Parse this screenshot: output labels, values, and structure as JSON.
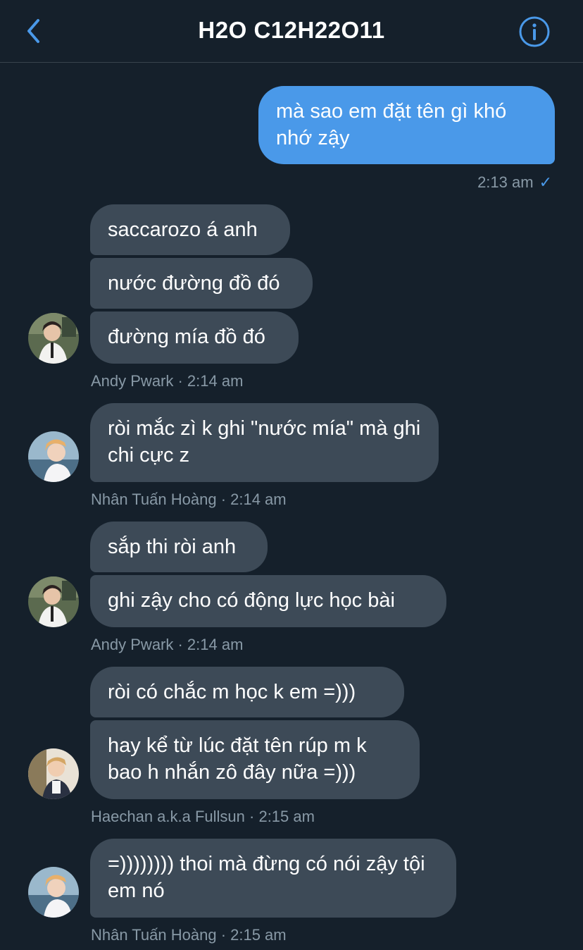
{
  "header": {
    "title": "H2O C12H22O11",
    "back_icon": "chevron-left-icon",
    "info_icon": "info-circle-icon",
    "accent": "#4a99e9"
  },
  "messages": {
    "m1": {
      "text": "mà sao em đặt tên gì khó nhớ zậy",
      "time": "2:13 am",
      "check": "✓"
    },
    "g1": {
      "bubbles": [
        "saccarozo á anh",
        "nước đường đồ đó",
        "đường mía đồ đó"
      ],
      "meta": "Andy Pwark · 2:14 am"
    },
    "g2": {
      "bubbles": [
        "ròi mắc zì k ghi \"nước mía\" mà ghi chi cực z"
      ],
      "meta": "Nhân Tuấn Hoàng · 2:14 am"
    },
    "g3": {
      "bubbles": [
        "sắp thi ròi anh",
        "ghi zậy cho có động lực học bài"
      ],
      "meta": "Andy Pwark · 2:14 am"
    },
    "g4": {
      "bubbles": [
        "ròi có chắc m học k em =)))",
        "hay kể từ lúc đặt tên rúp m k bao h nhắn zô đây nữa =)))"
      ],
      "meta": "Haechan a.k.a Fullsun · 2:15 am"
    },
    "g5": {
      "bubbles": [
        "=)))))))) thoi mà đừng có nói zậy tội em nó"
      ],
      "meta": "Nhân Tuấn Hoàng · 2:15 am"
    }
  },
  "colors": {
    "background": "#15202b",
    "incoming_bubble": "#3d4a57",
    "outgoing_bubble": "#4a99e9",
    "meta_text": "#8899a6"
  }
}
